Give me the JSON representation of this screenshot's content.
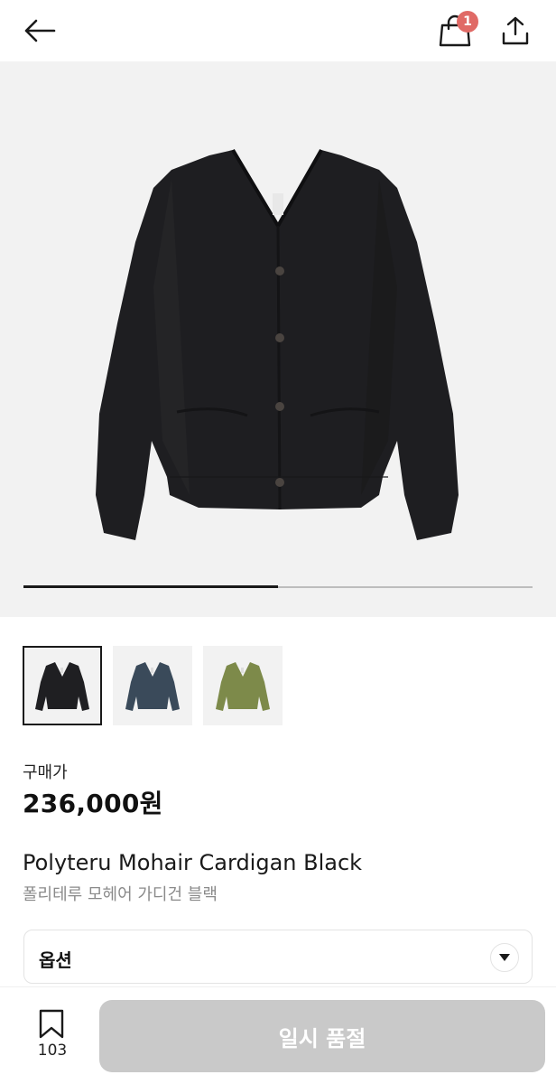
{
  "header": {
    "back_icon": "arrow-left-icon",
    "cart_icon": "shopping-bag-icon",
    "cart_badge_count": "1",
    "share_icon": "share-upload-icon",
    "badge_color": "#e06a66"
  },
  "gallery": {
    "image": "black-mohair-cardigan",
    "progress_fraction": 0.5
  },
  "thumbnails": [
    {
      "name": "black",
      "color": "#1f1f22",
      "selected": true
    },
    {
      "name": "blue",
      "color": "#3a4a5a",
      "selected": false
    },
    {
      "name": "olive",
      "color": "#7d8a4a",
      "selected": false
    }
  ],
  "price": {
    "label": "구매가",
    "value": "236,000원"
  },
  "product": {
    "name_en": "Polyteru Mohair Cardigan Black",
    "name_ko": "폴리테루 모헤어 가디건 블랙"
  },
  "option": {
    "label": "옵션",
    "caret_icon": "caret-down-icon"
  },
  "bottom_bar": {
    "bookmark_icon": "bookmark-icon",
    "bookmark_count": "103",
    "cta_label": "일시 품절",
    "cta_color": "#c9c9c9"
  }
}
